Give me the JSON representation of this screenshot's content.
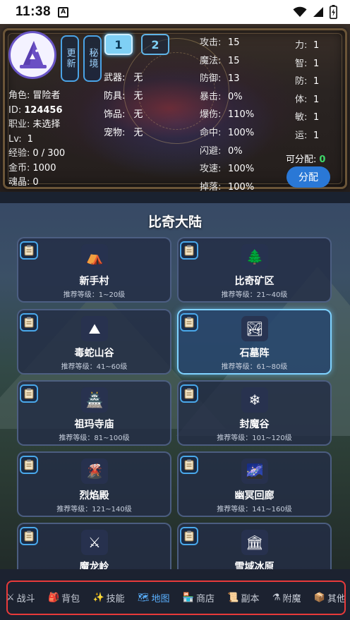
{
  "status_bar": {
    "time": "11:38",
    "app_badge": "A"
  },
  "header": {
    "side_buttons": [
      "更新",
      "秘境"
    ],
    "page_tabs": [
      "1",
      "2"
    ],
    "info": [
      {
        "label": "角色:",
        "value": "冒险者"
      },
      {
        "label": "ID:",
        "value": "124456"
      },
      {
        "label": "职业:",
        "value": "未选择"
      },
      {
        "label": "Lv:",
        "value": "1"
      },
      {
        "label": "经验:",
        "value": "0 / 300"
      },
      {
        "label": "金币:",
        "value": "1000"
      },
      {
        "label": "魂晶:",
        "value": "0"
      }
    ],
    "equipment": [
      {
        "label": "武器:",
        "value": "无"
      },
      {
        "label": "防具:",
        "value": "无"
      },
      {
        "label": "饰品:",
        "value": "无"
      },
      {
        "label": "宠物:",
        "value": "无"
      }
    ],
    "combat": [
      {
        "label": "攻击:",
        "value": "15"
      },
      {
        "label": "魔法:",
        "value": "15"
      },
      {
        "label": "防御:",
        "value": "13"
      },
      {
        "label": "暴击:",
        "value": "0%"
      },
      {
        "label": "爆伤:",
        "value": "110%"
      },
      {
        "label": "命中:",
        "value": "100%"
      },
      {
        "label": "闪避:",
        "value": "0%"
      },
      {
        "label": "攻速:",
        "value": "100%"
      },
      {
        "label": "掉落:",
        "value": "100%"
      }
    ],
    "attributes": [
      {
        "label": "力:",
        "value": "1"
      },
      {
        "label": "智:",
        "value": "1"
      },
      {
        "label": "防:",
        "value": "1"
      },
      {
        "label": "体:",
        "value": "1"
      },
      {
        "label": "敏:",
        "value": "1"
      },
      {
        "label": "运:",
        "value": "1"
      }
    ],
    "free_points_label": "可分配:",
    "free_points_value": "0",
    "assign_label": "分配"
  },
  "map": {
    "title": "比奇大陆",
    "zones": [
      {
        "name": "新手村",
        "level": "推荐等级：1~20级",
        "icon": "tent-icon",
        "emoji": "⛺"
      },
      {
        "name": "比奇矿区",
        "level": "推荐等级：21~40级",
        "icon": "tree-icon",
        "emoji": "🌲"
      },
      {
        "name": "毒蛇山谷",
        "level": "推荐等级：41~60级",
        "icon": "mountain-icon",
        "emoji": "⛰"
      },
      {
        "name": "石墓阵",
        "level": "推荐等级：61~80级",
        "icon": "landscape-icon",
        "emoji": "🏞"
      },
      {
        "name": "祖玛寺庙",
        "level": "推荐等级：81~100级",
        "icon": "castle-icon",
        "emoji": "🏯"
      },
      {
        "name": "封魔谷",
        "level": "推荐等级：101~120级",
        "icon": "snowflake-icon",
        "emoji": "❄"
      },
      {
        "name": "烈焰殿",
        "level": "推荐等级：121~140级",
        "icon": "volcano-icon",
        "emoji": "🌋"
      },
      {
        "name": "幽冥回廊",
        "level": "推荐等级：141~160级",
        "icon": "galaxy-icon",
        "emoji": "🌌"
      },
      {
        "name": "魔龙岭",
        "level": "",
        "icon": "crossed-swords-icon",
        "emoji": "⚔"
      },
      {
        "name": "雪域冰原",
        "level": "",
        "icon": "classical-building-icon",
        "emoji": "🏛"
      }
    ]
  },
  "nav": [
    {
      "label": "战斗",
      "emoji": "⚔"
    },
    {
      "label": "背包",
      "emoji": "🎒"
    },
    {
      "label": "技能",
      "emoji": "✨"
    },
    {
      "label": "地图",
      "emoji": "🗺"
    },
    {
      "label": "商店",
      "emoji": "🏪"
    },
    {
      "label": "副本",
      "emoji": "📜"
    },
    {
      "label": "附魔",
      "emoji": "⚗"
    },
    {
      "label": "其他",
      "emoji": "📦"
    }
  ],
  "colors": {
    "accent": "#2a78d6",
    "tab_active": "#7fd0f5",
    "nav_active": "#5ab0ff",
    "highlight_outline": "#e83a3a",
    "free_points": "#3fd86a"
  }
}
